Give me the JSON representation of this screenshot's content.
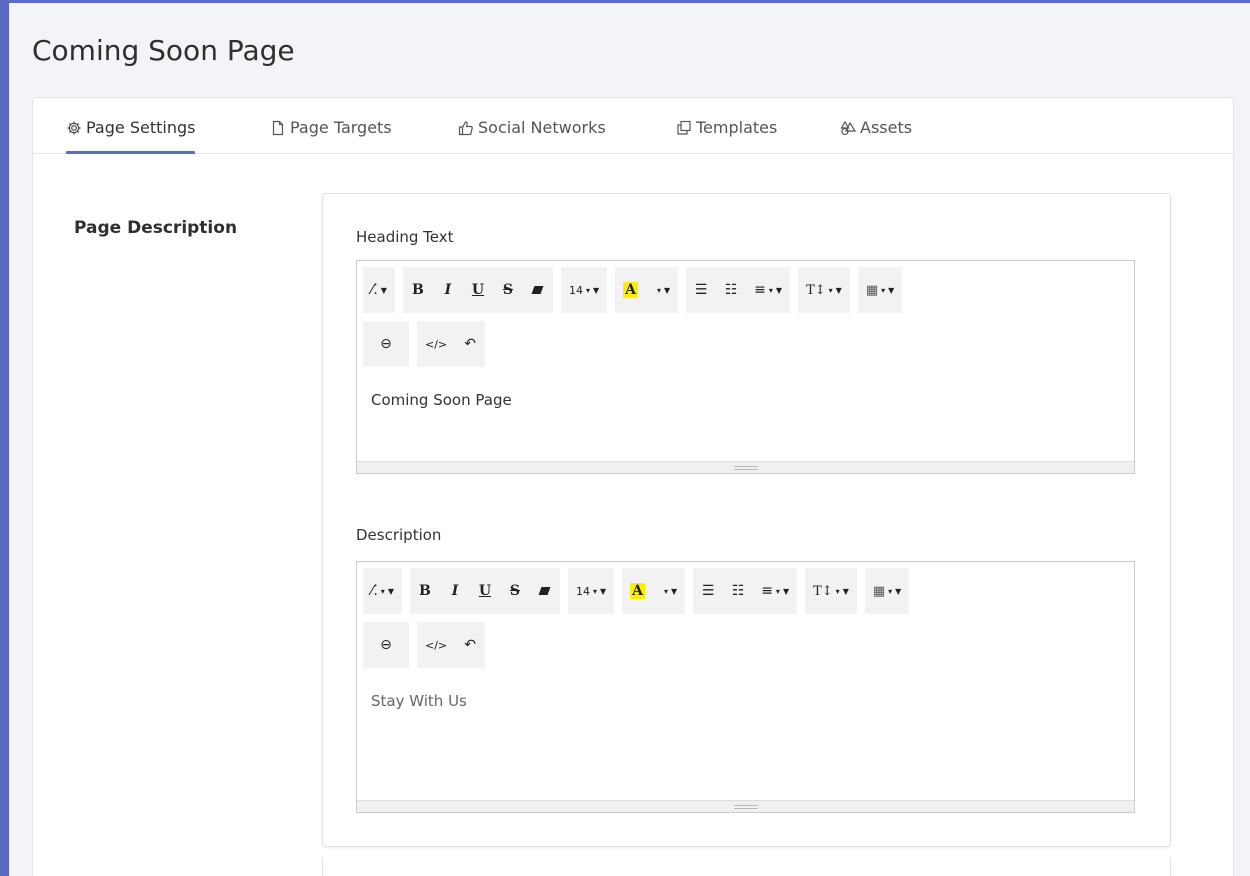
{
  "page": {
    "title": "Coming Soon Page"
  },
  "tabs": [
    {
      "label": "Page Settings",
      "icon": "gear-icon",
      "active": true
    },
    {
      "label": "Page Targets",
      "icon": "page-icon",
      "active": false
    },
    {
      "label": "Social Networks",
      "icon": "thumbs-up-icon",
      "active": false
    },
    {
      "label": "Templates",
      "icon": "copy-icon",
      "active": false
    },
    {
      "label": "Assets",
      "icon": "shapes-icon",
      "active": false
    }
  ],
  "section": {
    "label": "Page Description"
  },
  "editors": [
    {
      "label": "Heading Text",
      "content": "Coming Soon Page",
      "placeholder": false
    },
    {
      "label": "Description",
      "content": "Stay With Us",
      "placeholder": true
    }
  ],
  "toolbar": {
    "bold": "B",
    "italic": "I",
    "underline": "U",
    "strike": "S",
    "font_size": "14",
    "color_letter": "A",
    "line_height": "T↕",
    "code": "</>"
  },
  "colors": {
    "accent": "#5b6bc4",
    "highlight": "#ffee00"
  }
}
